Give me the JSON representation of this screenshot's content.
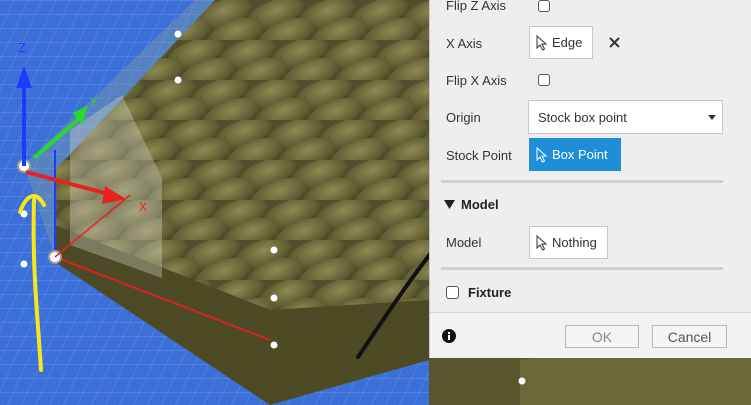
{
  "panel": {
    "flip_z_axis_label": "Flip Z Axis",
    "x_axis_label": "X Axis",
    "x_axis_value": "Edge",
    "flip_x_axis_label": "Flip X Axis",
    "origin_label": "Origin",
    "origin_value": "Stock box point",
    "stock_point_label": "Stock Point",
    "stock_point_value": "Box Point",
    "model_section_label": "Model",
    "model_label": "Model",
    "model_value": "Nothing",
    "fixture_label": "Fixture",
    "ok_label": "OK",
    "cancel_label": "Cancel"
  },
  "viewport": {
    "axis_x": "X",
    "axis_y": "Y",
    "axis_z": "Z"
  },
  "colors": {
    "accent": "#1e8fd6",
    "viewport_bg": "#3c6fd8",
    "model": "#5b5a32"
  },
  "icons": [
    "cursor-select-icon",
    "close-icon",
    "info-icon",
    "chevron-down-icon",
    "triangle-down-icon"
  ]
}
